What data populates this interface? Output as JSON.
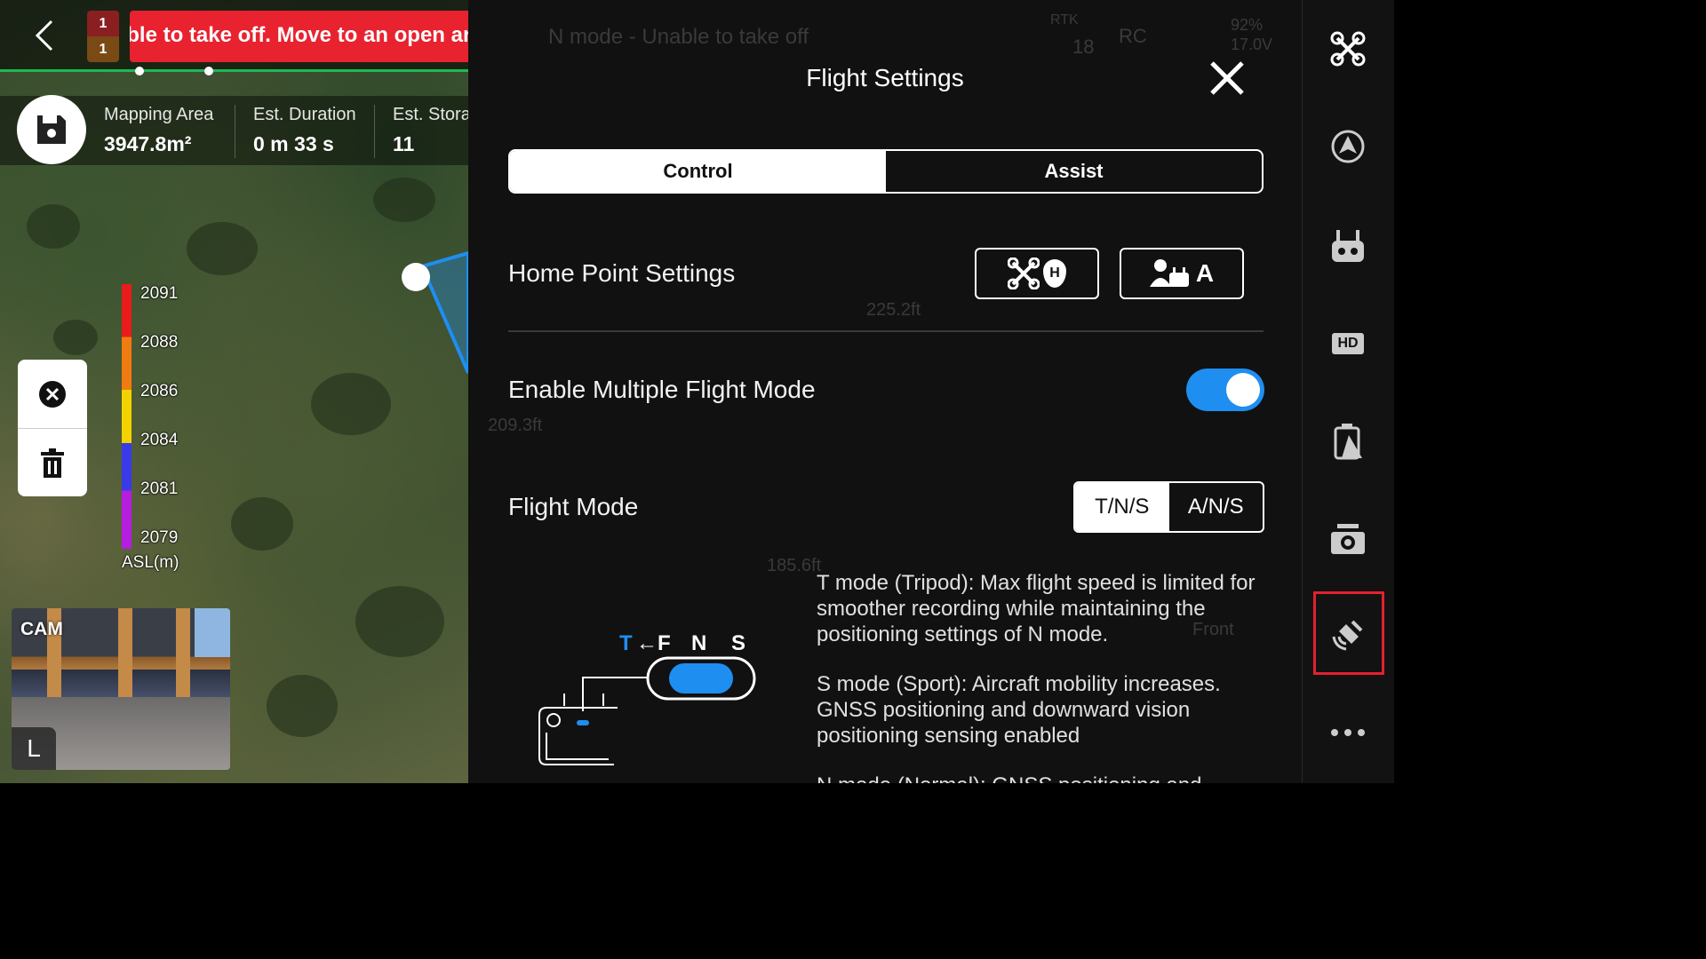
{
  "warning": {
    "badge_top": "1",
    "badge_bottom": "1",
    "banner_text": "Unable to take off. Move to an open area",
    "ghost_status": "N mode - Unable to take off"
  },
  "ghost_header": {
    "rtk": "RTK",
    "satellites": "18",
    "rc": "RC",
    "battery_pct": "92%",
    "battery_v": "17.0V"
  },
  "mission_stats": {
    "area_label": "Mapping Area",
    "area_value": "3947.8m²",
    "duration_label": "Est. Duration",
    "duration_value": "0 m 33 s",
    "storage_label": "Est. Storage",
    "storage_value": "11"
  },
  "altitude_legend": {
    "ticks": [
      "2091",
      "2088",
      "2086",
      "2084",
      "2081",
      "2079"
    ],
    "unit": "ASL(m)"
  },
  "map_overlay": {
    "dist_1": "225.2ft",
    "dist_2": "209.3ft",
    "dist_3": "185.6ft",
    "front": "Front"
  },
  "camera": {
    "label": "CAM",
    "mode_button": "L"
  },
  "settings": {
    "title": "Flight Settings",
    "tabs": [
      "Control",
      "Assist"
    ],
    "active_tab": "Control",
    "home_point_label": "Home Point Settings",
    "home_btn_aircraft": "H",
    "home_btn_rc": "A",
    "multi_mode_label": "Enable Multiple Flight Mode",
    "multi_mode_on": true,
    "flight_mode_label": "Flight Mode",
    "flight_mode_options": [
      "T/N/S",
      "A/N/S"
    ],
    "flight_mode_selected": "T/N/S",
    "switch_labels": {
      "t": "T",
      "f": "←F",
      "n": "N",
      "s": "S"
    },
    "desc_t": "T mode (Tripod): Max flight speed is limited for smoother recording while maintaining the positioning settings of N mode.",
    "desc_s": "S mode (Sport): Aircraft mobility increases. GNSS positioning and downward vision positioning sensing enabled",
    "desc_n": "N mode (Normal): GNSS positioning and"
  },
  "rail": {
    "icons": [
      "aircraft-icon",
      "obstacle-avoidance-icon",
      "remote-controller-icon",
      "hd-transmission-icon",
      "battery-icon",
      "camera-icon",
      "rtk-icon",
      "more-icon"
    ],
    "hd_label": "HD",
    "selected": "rtk-icon",
    "highlight_color": "#e5202f"
  },
  "colors": {
    "accent": "#1f8ef1",
    "warning": "#e8222f",
    "route": "#1f8ef1"
  }
}
